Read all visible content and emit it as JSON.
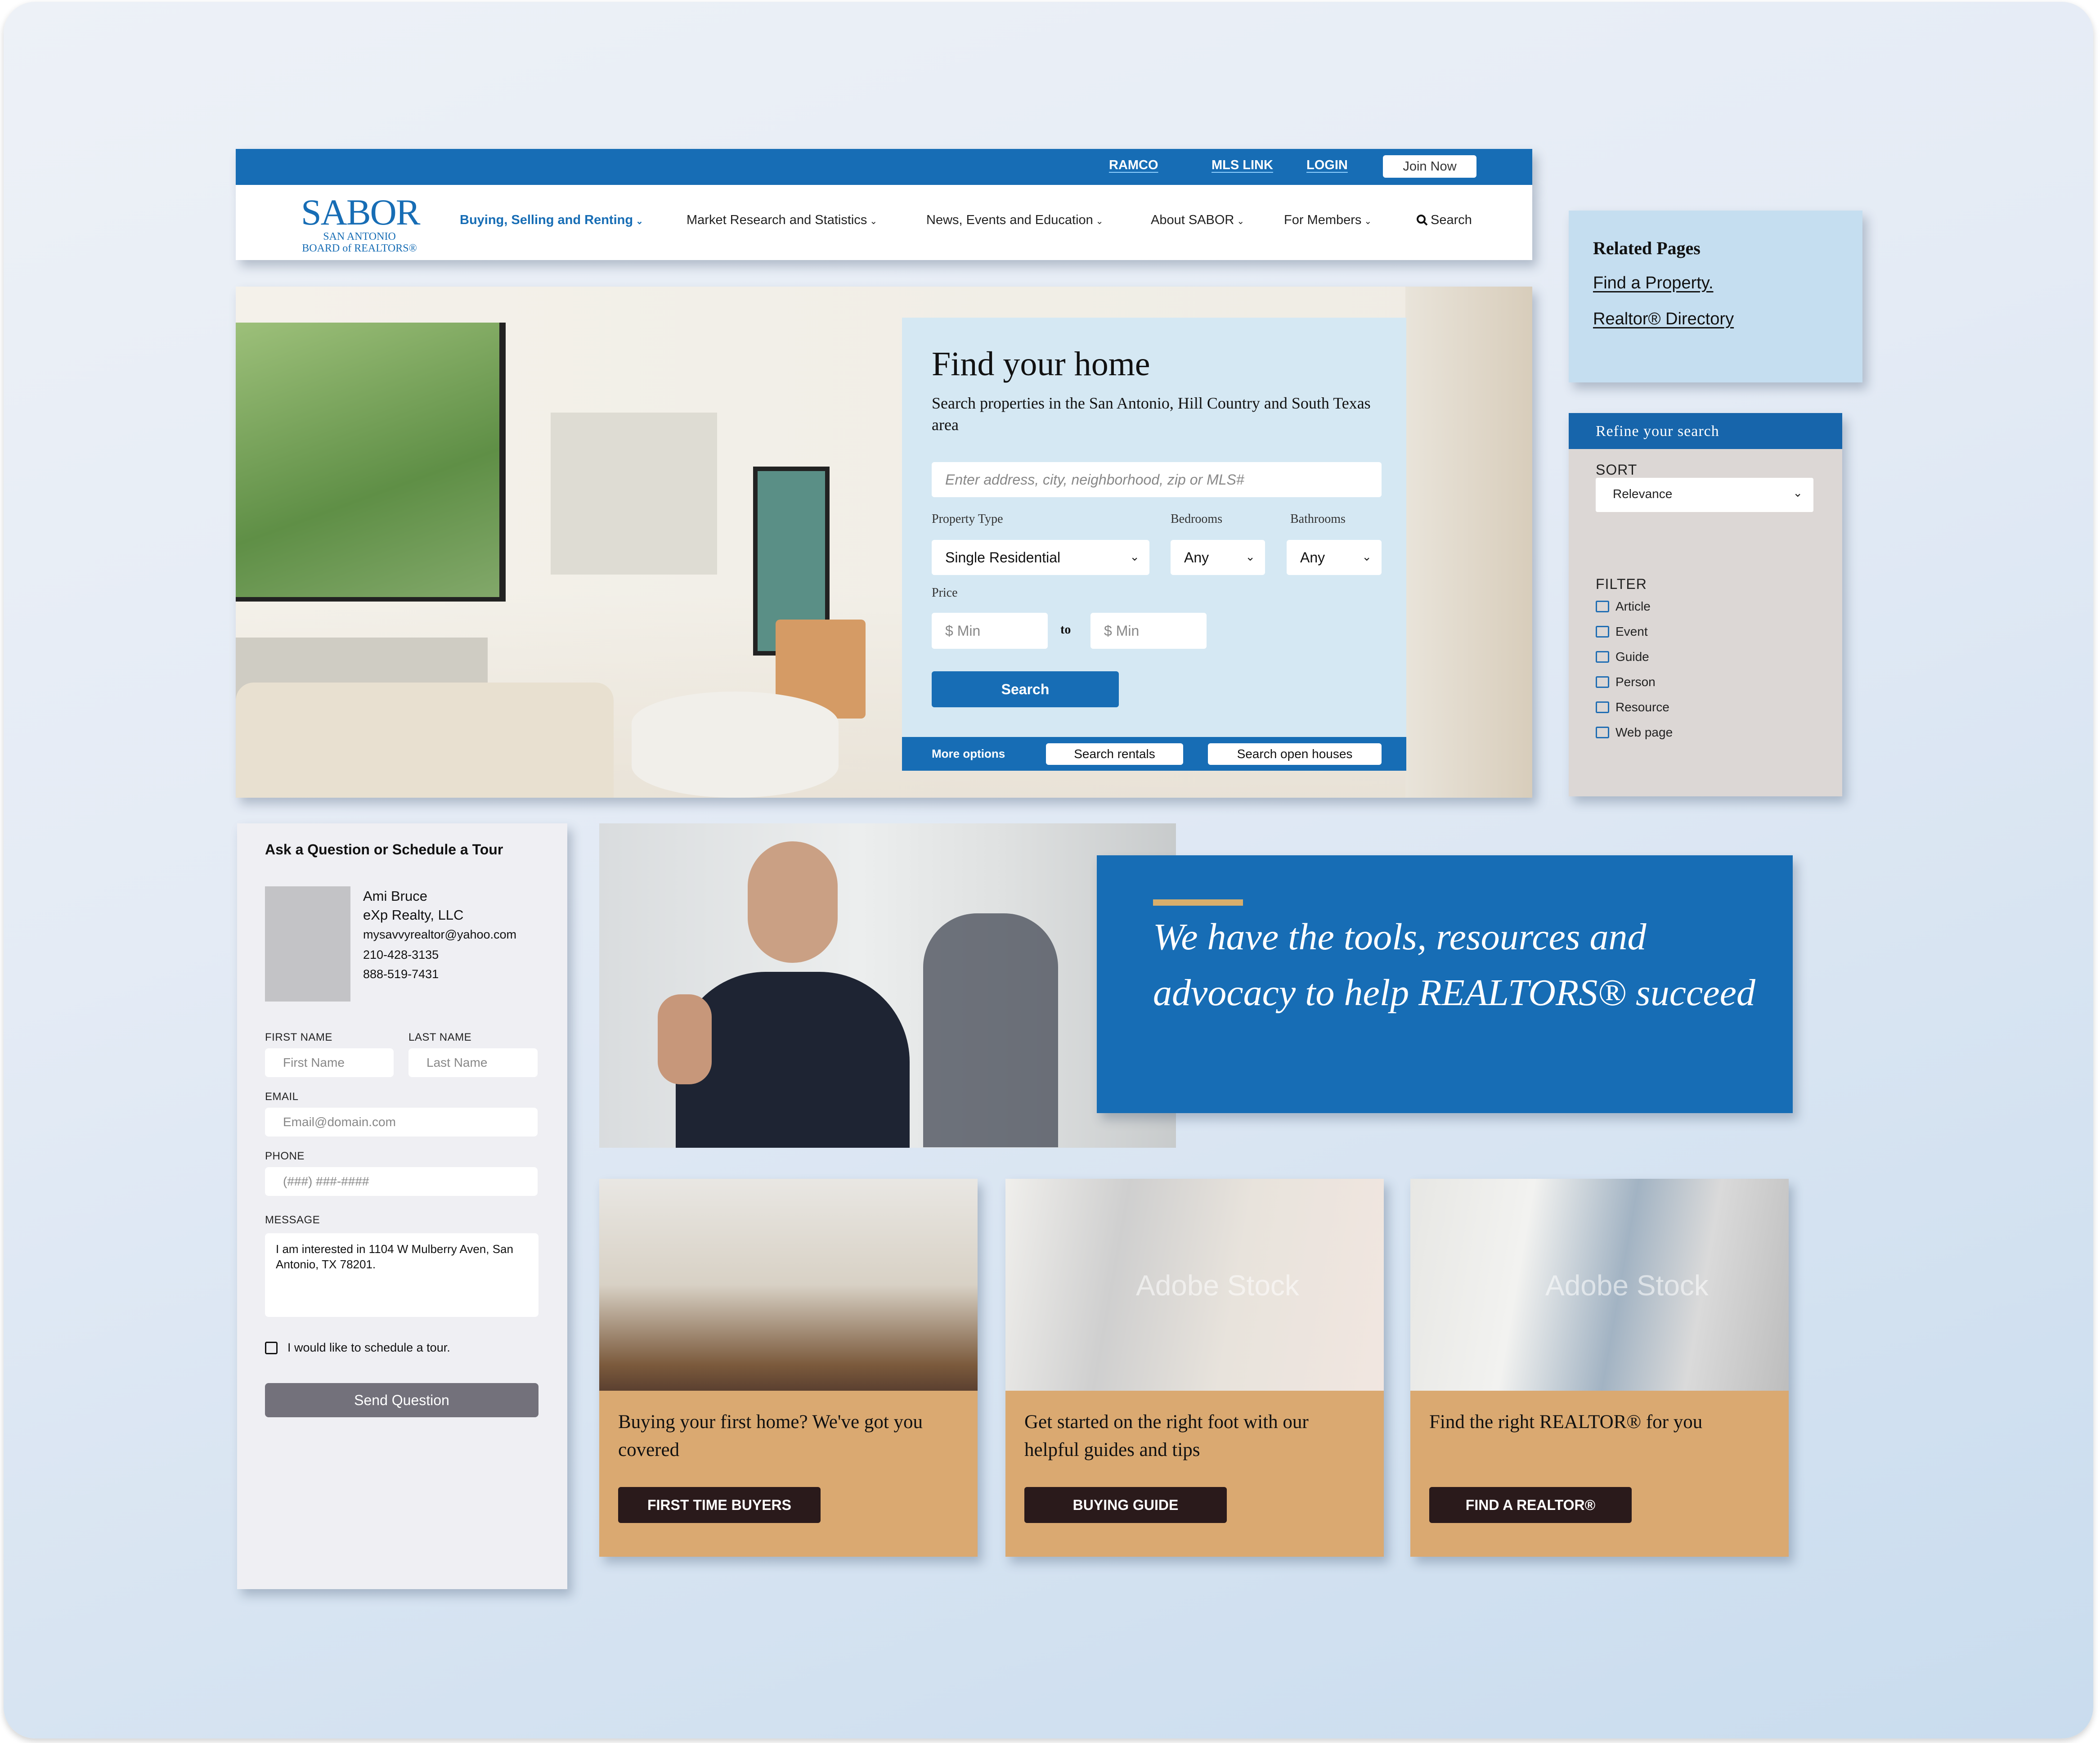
{
  "topbar": {
    "links": [
      "RAMCO",
      "MLS LINK",
      "LOGIN"
    ],
    "join_label": "Join Now"
  },
  "logo": {
    "wordmark": "SABOR",
    "line1": "SAN ANTONIO",
    "line2": "BOARD of REALTORS®"
  },
  "nav": {
    "items": [
      {
        "label": "Buying, Selling and Renting",
        "active": true
      },
      {
        "label": "Market Research and Statistics",
        "active": false
      },
      {
        "label": "News, Events and Education",
        "active": false
      },
      {
        "label": "About SABOR",
        "active": false
      },
      {
        "label": "For Members",
        "active": false
      }
    ],
    "search_label": "Search",
    "dropdown_glyph": "⌄"
  },
  "search_panel": {
    "title": "Find your home",
    "subtitle": "Search properties in the San Antonio, Hill Country and South Texas area",
    "address_placeholder": "Enter address, city, neighborhood, zip or MLS#",
    "property_type_label": "Property Type",
    "property_type_value": "Single Residential",
    "bedrooms_label": "Bedrooms",
    "bedrooms_value": "Any",
    "bathrooms_label": "Bathrooms",
    "bathrooms_value": "Any",
    "price_label": "Price",
    "price_min_placeholder": "$ Min",
    "price_to": "to",
    "price_max_placeholder": "$ Min",
    "search_button": "Search",
    "more_options": "More options",
    "search_rentals": "Search rentals",
    "search_open_houses": "Search open houses"
  },
  "related": {
    "title": "Related Pages",
    "links": [
      "Find a Property.",
      "Realtor® Directory"
    ]
  },
  "refine": {
    "title": "Refine your search",
    "sort_label": "SORT",
    "sort_value": "Relevance",
    "filter_label": "FILTER",
    "filters": [
      "Article",
      "Event",
      "Guide",
      "Person",
      "Resource",
      "Web page"
    ]
  },
  "contact": {
    "title": "Ask a Question or Schedule a Tour",
    "agent_name": "Ami Bruce",
    "agent_company": "eXp Realty, LLC",
    "agent_email": "mysavvyrealtor@yahoo.com",
    "agent_phone1": "210-428-3135",
    "agent_phone2": "888-519-7431",
    "first_name_label": "FIRST NAME",
    "first_name_placeholder": "First Name",
    "last_name_label": "LAST NAME",
    "last_name_placeholder": "Last Name",
    "email_label": "EMAIL",
    "email_placeholder": "Email@domain.com",
    "phone_label": "PHONE",
    "phone_placeholder": "(###) ###-####",
    "message_label": "MESSAGE",
    "message_value": "I am interested in 1104 W Mulberry Aven, San Antonio, TX 78201.",
    "tour_checkbox_label": "I would like to schedule a tour.",
    "send_button": "Send Question"
  },
  "banner": {
    "quote": "We have the tools, resources and advocacy to help REALTORS® succeed"
  },
  "cards": [
    {
      "text": "Buying your first home? We've got you covered",
      "button": "FIRST TIME BUYERS"
    },
    {
      "text": "Get started on the right foot with our helpful guides and tips",
      "button": "BUYING GUIDE",
      "watermark": "Adobe Stock"
    },
    {
      "text": "Find the right REALTOR® for you",
      "button": "FIND A REALTOR®",
      "watermark": "Adobe Stock"
    }
  ],
  "colors": {
    "brand_blue": "#176db5",
    "panel_light_blue": "#d5e8f3",
    "card_tan": "#daa971",
    "button_dark": "#2a1a1b",
    "accent_gold": "#d8ae6c",
    "send_button_gray": "#73717b"
  }
}
